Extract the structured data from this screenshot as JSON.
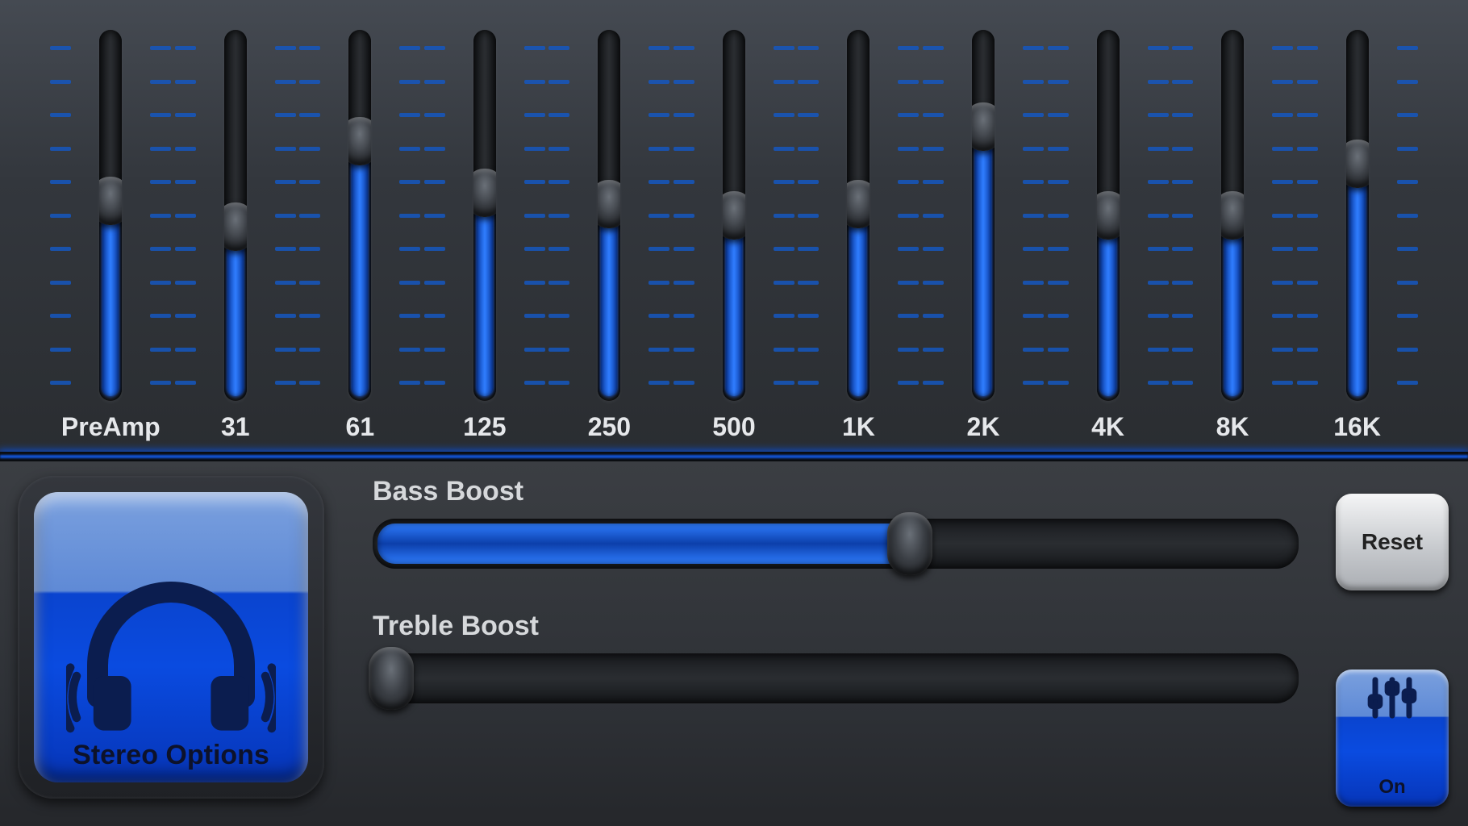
{
  "colors": {
    "accent": "#1a63ff",
    "track": "#1c1e21"
  },
  "equalizer": {
    "bands": [
      {
        "label": "PreAmp",
        "value": 54
      },
      {
        "label": "31",
        "value": 47
      },
      {
        "label": "61",
        "value": 70
      },
      {
        "label": "125",
        "value": 56
      },
      {
        "label": "250",
        "value": 53
      },
      {
        "label": "500",
        "value": 50
      },
      {
        "label": "1K",
        "value": 53
      },
      {
        "label": "2K",
        "value": 74
      },
      {
        "label": "4K",
        "value": 50
      },
      {
        "label": "8K",
        "value": 50
      },
      {
        "label": "16K",
        "value": 64
      }
    ]
  },
  "stereo": {
    "label": "Stereo Options"
  },
  "bass": {
    "label": "Bass Boost",
    "value": 58
  },
  "treble": {
    "label": "Treble Boost",
    "value": 2
  },
  "buttons": {
    "reset": "Reset",
    "on": "On"
  }
}
